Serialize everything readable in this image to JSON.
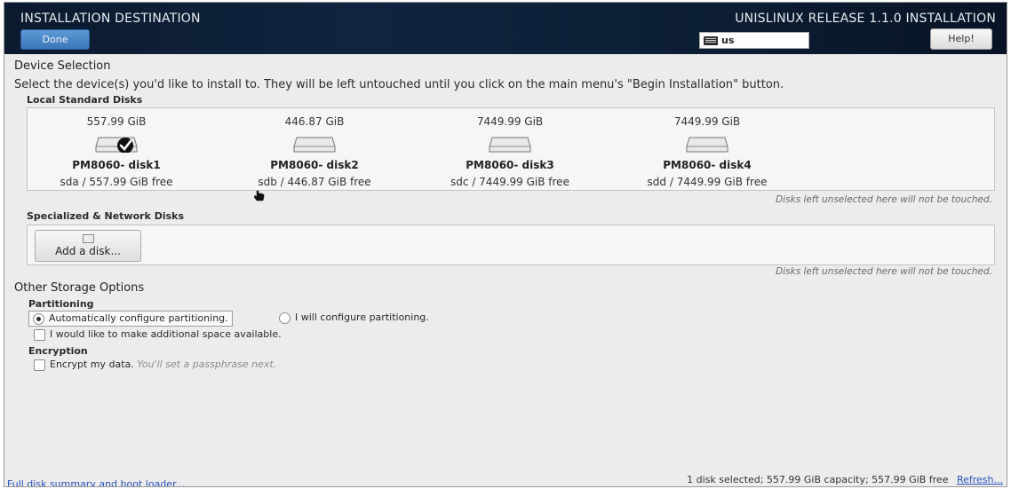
{
  "header": {
    "title": "INSTALLATION DESTINATION",
    "done_label": "Done",
    "release": "UNISLINUX RELEASE 1.1.0 INSTALLATION",
    "keyboard_layout": "us",
    "help_label": "Help!"
  },
  "device_selection": {
    "heading": "Device Selection",
    "instruction": "Select the device(s) you'd like to install to.  They will be left untouched until you click on the main menu's \"Begin Installation\" button.",
    "local_heading": "Local Standard Disks",
    "disks": [
      {
        "size": "557.99 GiB",
        "name": "PM8060- disk1",
        "free": "sda / 557.99 GiB free",
        "selected": true
      },
      {
        "size": "446.87 GiB",
        "name": "PM8060- disk2",
        "free": "sdb / 446.87 GiB free",
        "selected": false
      },
      {
        "size": "7449.99 GiB",
        "name": "PM8060- disk3",
        "free": "sdc / 7449.99 GiB free",
        "selected": false
      },
      {
        "size": "7449.99 GiB",
        "name": "PM8060- disk4",
        "free": "sdd / 7449.99 GiB free",
        "selected": false
      }
    ],
    "local_note": "Disks left unselected here will not be touched.",
    "specialized_heading": "Specialized & Network Disks",
    "add_disk_label": "Add a disk...",
    "specialized_note": "Disks left unselected here will not be touched."
  },
  "other_storage": {
    "heading": "Other Storage Options",
    "partitioning_heading": "Partitioning",
    "auto_partition_label": "Automatically configure partitioning.",
    "manual_partition_label": "I will configure partitioning.",
    "auto_partition_selected": true,
    "additional_space_label": "I would like to make additional space available.",
    "encryption_heading": "Encryption",
    "encrypt_label": "Encrypt my data.",
    "encrypt_hint": "You'll set a passphrase next."
  },
  "footer": {
    "summary_link": "Full disk summary and boot loader...",
    "status": "1 disk selected; 557.99 GiB capacity; 557.99 GiB free",
    "refresh_link": "Refresh..."
  },
  "colors": {
    "header_bg": "#0d1f36",
    "done_button": "#3a76b8",
    "link": "#2a52be"
  }
}
